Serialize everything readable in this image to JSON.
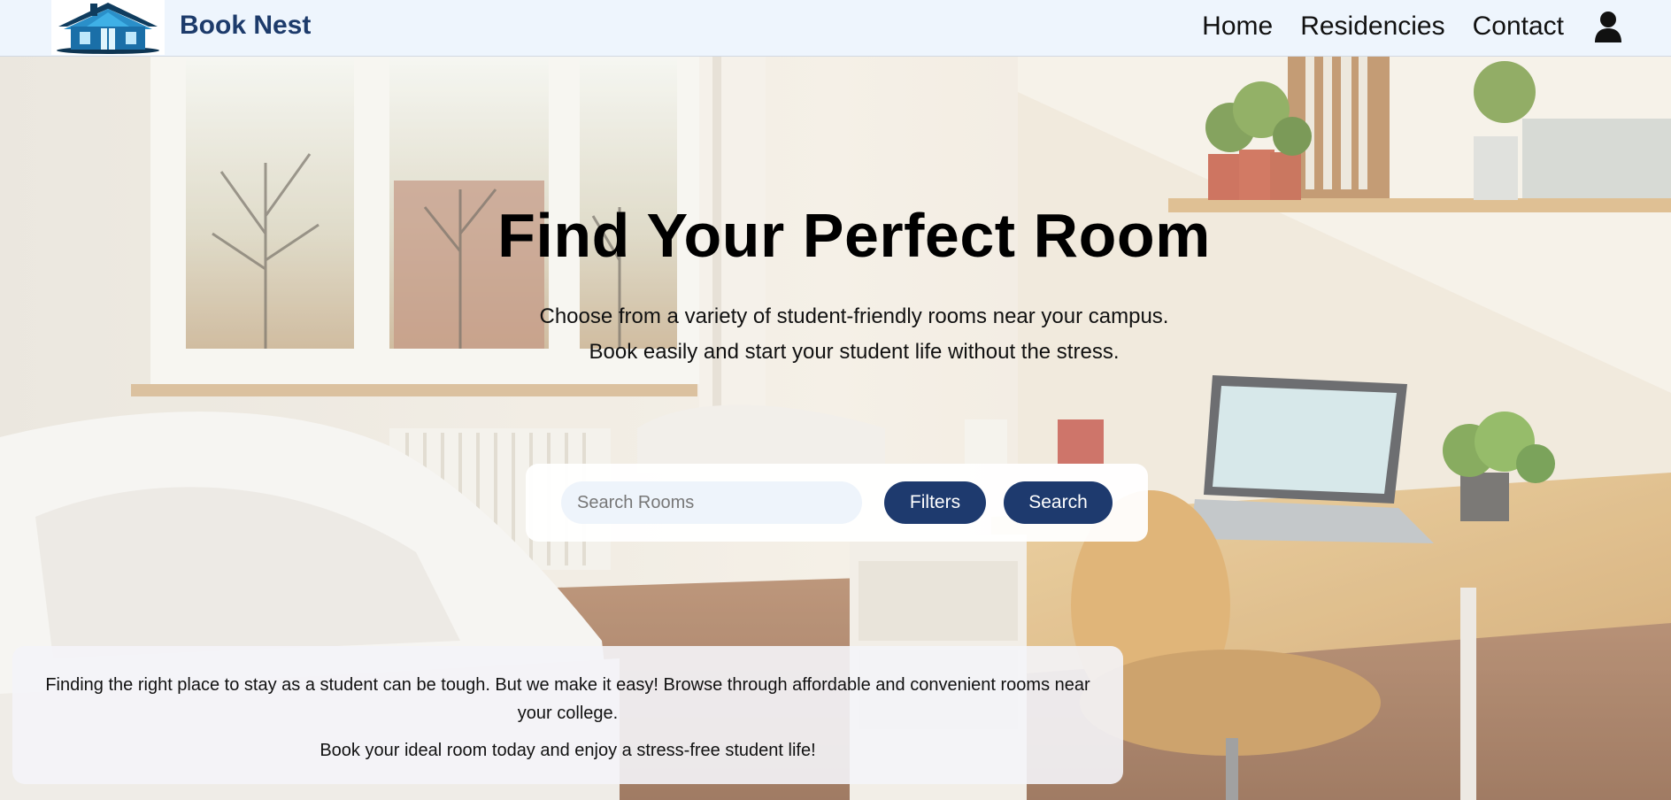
{
  "header": {
    "brand": "Book Nest",
    "nav": [
      "Home",
      "Residencies",
      "Contact"
    ],
    "user_icon": "user-icon",
    "logo_icon": "house-logo"
  },
  "hero": {
    "title": "Find Your Perfect Room",
    "subtitle_line1": "Choose from a variety of student-friendly rooms near your campus.",
    "subtitle_line2": "Book easily and start your student life without the stress."
  },
  "search": {
    "placeholder": "Search Rooms",
    "filters_label": "Filters",
    "search_label": "Search"
  },
  "info": {
    "paragraph1": "Finding the right place to stay as a student can be tough. But we make it easy! Browse through affordable and convenient rooms near your college.",
    "paragraph2": "Book your ideal room today and enjoy a stress-free student life!"
  },
  "colors": {
    "brand": "#1d3b6b",
    "button": "#1e3a6e",
    "header_bg": "#eef5fd"
  }
}
